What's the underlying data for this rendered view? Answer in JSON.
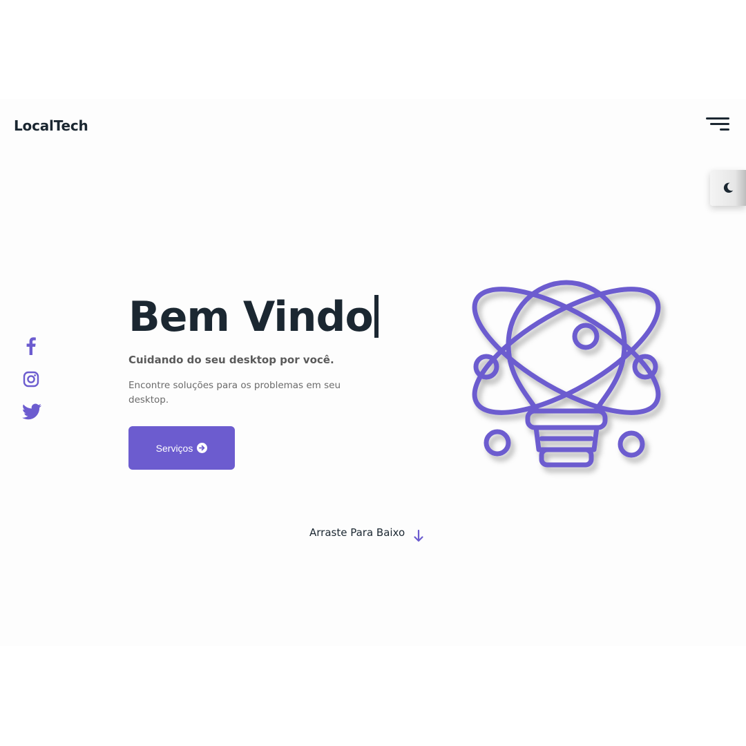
{
  "header": {
    "logo": "LocalTech",
    "menu_icon": "hamburger-menu-icon",
    "theme_icon": "moon-icon"
  },
  "social": [
    {
      "name": "facebook",
      "icon": "facebook-icon"
    },
    {
      "name": "instagram",
      "icon": "instagram-icon"
    },
    {
      "name": "twitter",
      "icon": "twitter-icon"
    }
  ],
  "hero": {
    "title": "Bem Vindo",
    "subtitle": "Cuidando do seu desktop por você.",
    "description": "Encontre soluções para os problemas em seu desktop.",
    "button_label": "Serviços",
    "button_icon": "arrow-circle-right-icon",
    "illustration": "lightbulb-rocket-icon"
  },
  "scroll": {
    "label": "Arraste Para Baixo",
    "icon": "arrow-down-icon"
  },
  "colors": {
    "accent": "#6c5ccf",
    "text_dark": "#1b2731",
    "background": "#fdfdfd"
  }
}
